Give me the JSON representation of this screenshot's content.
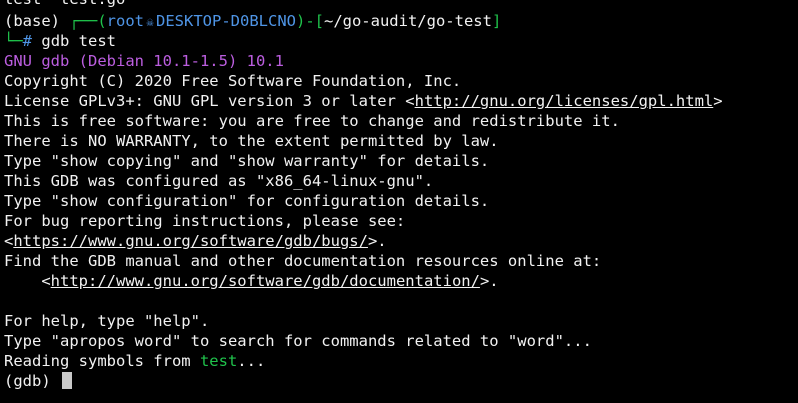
{
  "colors": {
    "background": "#000000",
    "text": "#f2f2f2",
    "prompt_green": "#1fc24b",
    "prompt_blue": "#4f95e6",
    "prompt_red": "#e0392e",
    "gdb_banner_purple": "#bc5ee0",
    "filename_green": "#1fc24b"
  },
  "prev_line": {
    "a": "test",
    "b": "test.go"
  },
  "prompt": {
    "env": "(base)",
    "corner_top": "┌──(",
    "user": "root",
    "skull_icon": "☠",
    "host": "DESKTOP-D0BLCNO",
    "sep": ")-[",
    "cwd": "~/go-audit/go-test",
    "close": "]",
    "corner_bottom": "└─",
    "hash": "#",
    "command": "gdb test"
  },
  "banner": "GNU gdb (Debian 10.1-1.5) 10.1",
  "output": {
    "copyright": "Copyright (C) 2020 Free Software Foundation, Inc.",
    "license_pre": "License GPLv3+: GNU GPL version 3 or later <",
    "license_url": "http://gnu.org/licenses/gpl.html",
    "license_post": ">",
    "free": "This is free software: you are free to change and redistribute it.",
    "warranty": "There is NO WARRANTY, to the extent permitted by law.",
    "show": "Type \"show copying\" and \"show warranty\" for details.",
    "configured": "This GDB was configured as \"x86_64-linux-gnu\".",
    "show_config": "Type \"show configuration\" for configuration details.",
    "bug": "For bug reporting instructions, please see:",
    "bug_url_pre": "<",
    "bug_url": "https://www.gnu.org/software/gdb/bugs/",
    "bug_url_post": ">.",
    "manual": "Find the GDB manual and other documentation resources online at:",
    "doc_url_pre": "    <",
    "doc_url": "http://www.gnu.org/software/gdb/documentation/",
    "doc_url_post": ">.",
    "help": "For help, type \"help\".",
    "apropos": "Type \"apropos word\" to search for commands related to \"word\"...",
    "reading_pre": "Reading symbols from ",
    "reading_file": "test",
    "reading_post": "...",
    "gdb_prompt": "(gdb) "
  }
}
